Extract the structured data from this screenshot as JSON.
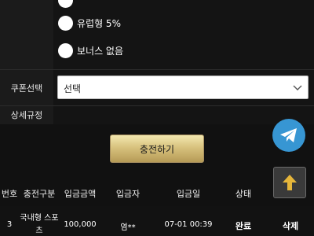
{
  "bonus_options": [
    {
      "label": "유럽형 5%"
    },
    {
      "label": "보너스 없음"
    }
  ],
  "coupon": {
    "label": "쿠폰선택",
    "selected": "선택"
  },
  "detail": {
    "label": "상세규정"
  },
  "charge_button": "충전하기",
  "history": {
    "headers": [
      "번호",
      "충전구분",
      "입금금액",
      "입금자",
      "입금일",
      "상태"
    ],
    "rows": [
      {
        "no": "3",
        "type_line1": "국내형 스포",
        "type_line2": "츠",
        "amount": "100,000",
        "depositor": "염**",
        "date": "07-01 00:39",
        "status": "완료",
        "action": "삭제"
      }
    ]
  },
  "icons": {
    "telegram": "telegram-icon",
    "scroll_top": "arrow-up-icon",
    "dropdown": "chevron-down-icon"
  },
  "colors": {
    "telegram": "#3796d3",
    "gold_button": "#d8c27e",
    "scroll_top_arrow": "#e5b53a"
  }
}
